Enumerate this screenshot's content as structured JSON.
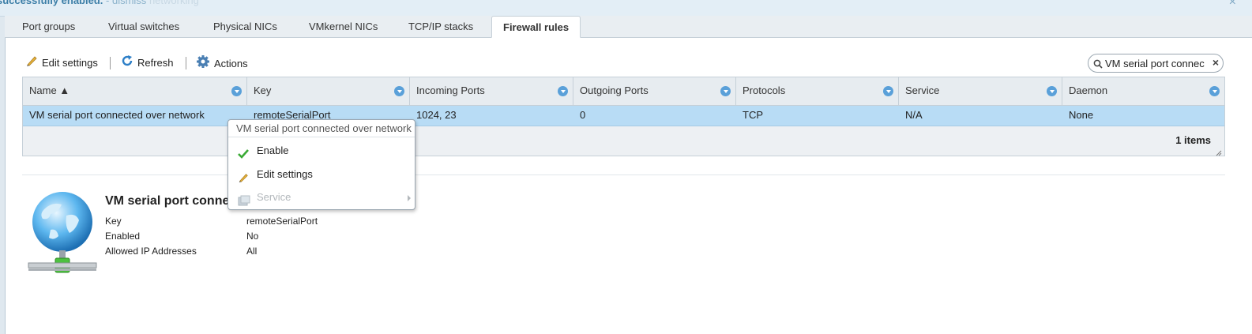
{
  "banner": {
    "message": "successfully enabled.",
    "dismiss": "- dismiss",
    "ghost": "networking",
    "close": "×"
  },
  "tabs": [
    {
      "label": "Port groups"
    },
    {
      "label": "Virtual switches"
    },
    {
      "label": "Physical NICs"
    },
    {
      "label": "VMkernel NICs"
    },
    {
      "label": "TCP/IP stacks"
    },
    {
      "label": "Firewall rules",
      "active": true
    }
  ],
  "toolbar": {
    "edit_label": "Edit settings",
    "refresh_label": "Refresh",
    "actions_label": "Actions"
  },
  "search": {
    "value": "VM serial port connec",
    "clear": "×"
  },
  "grid": {
    "columns": [
      "Name ▲",
      "Key",
      "Incoming Ports",
      "Outgoing Ports",
      "Protocols",
      "Service",
      "Daemon"
    ],
    "rows": [
      [
        "VM serial port connected over network",
        "remoteSerialPort",
        "1024, 23",
        "0",
        "TCP",
        "N/A",
        "None"
      ]
    ],
    "count": "1 items"
  },
  "detail": {
    "title": "VM serial port connected over network",
    "fields": [
      {
        "label": "Key",
        "value": "remoteSerialPort"
      },
      {
        "label": "Enabled",
        "value": "No"
      },
      {
        "label": "Allowed IP Addresses",
        "value": "All"
      }
    ]
  },
  "context_menu": {
    "title": "VM serial port connected over network",
    "items": [
      {
        "label": "Enable",
        "icon": "check-icon"
      },
      {
        "label": "Edit settings",
        "icon": "pencil-icon"
      },
      {
        "label": "Service",
        "icon": "service-icon",
        "disabled": true,
        "submenu": true
      }
    ]
  },
  "colors": {
    "accent": "#5aa0d9",
    "selected_row": "#b8dcf5",
    "banner_text": "#3d7fa8",
    "enable_check": "#3aaa35"
  }
}
